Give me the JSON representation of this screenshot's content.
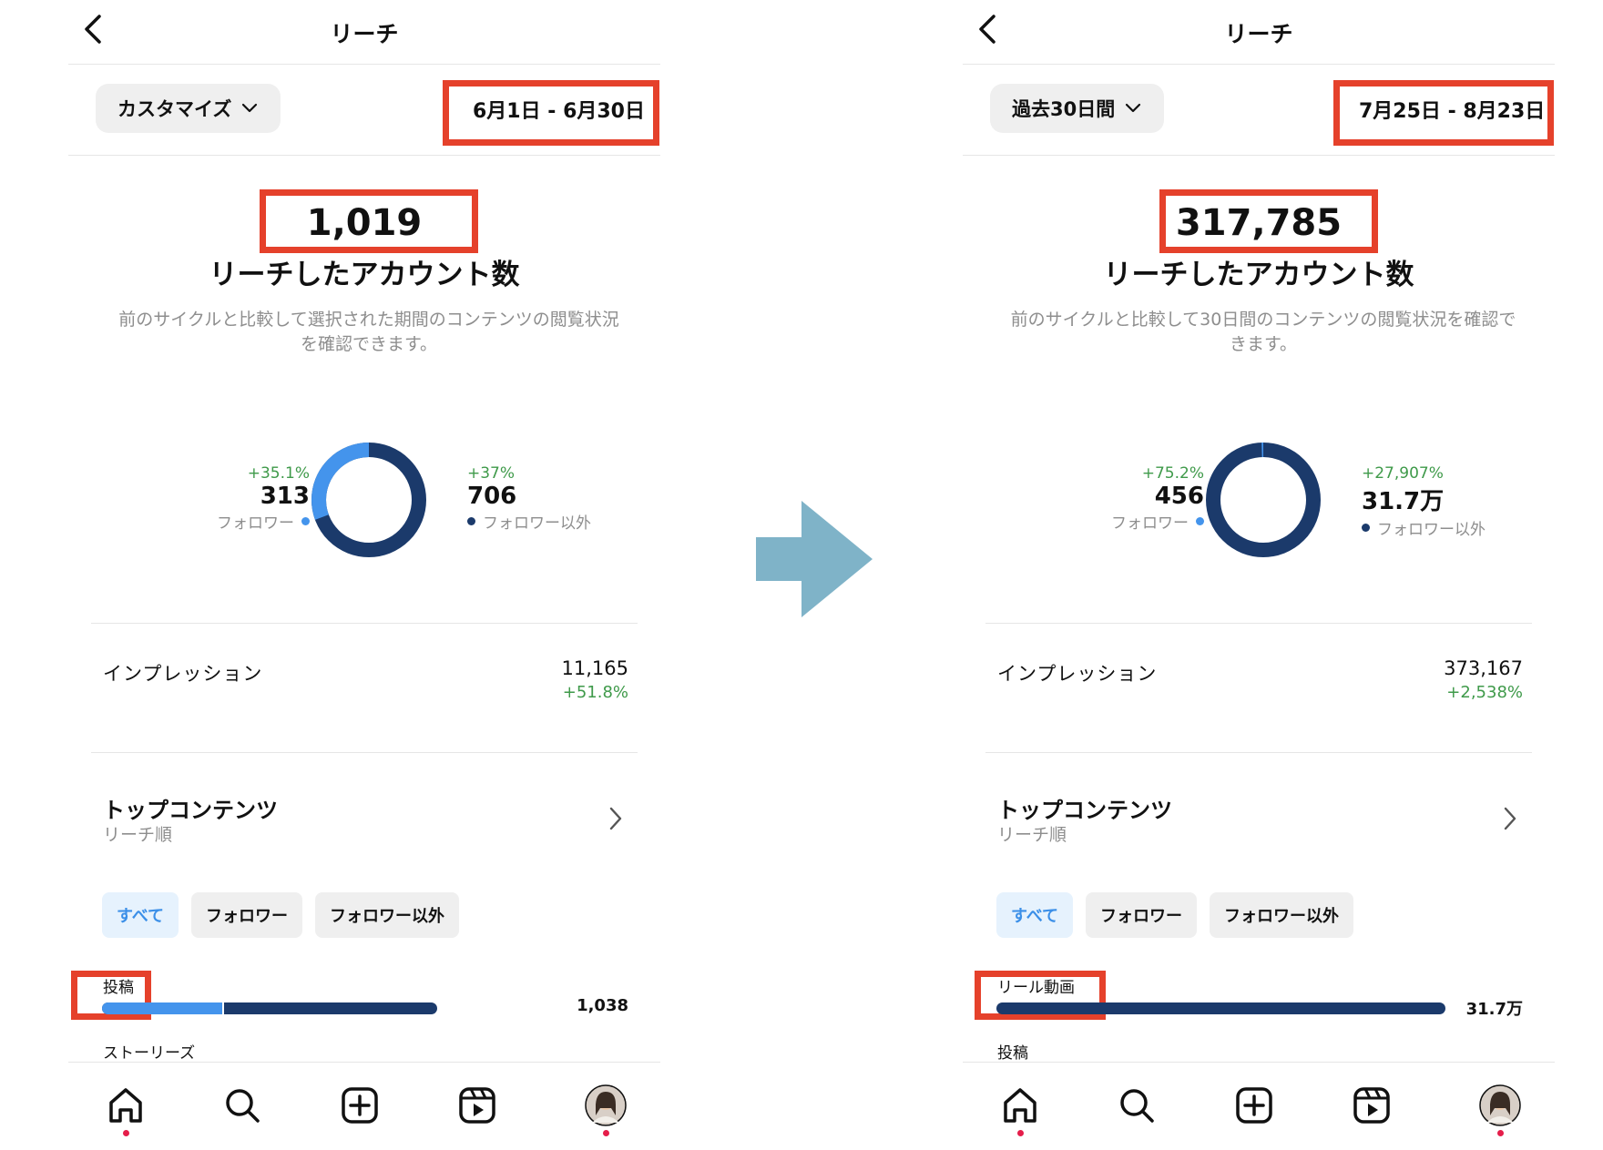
{
  "colors": {
    "accent_blue": "#4494ec",
    "navy": "#1b3a6b",
    "positive_green": "#3f9a4a",
    "highlight_red": "#e5412b",
    "arrow": "#7fb3c8",
    "notification_dot": "#e51d4a"
  },
  "icons": {
    "back": "chevron-left-icon",
    "period": "chevron-down-icon",
    "top_content": "chevron-right-icon",
    "nav": [
      "home-icon",
      "search-icon",
      "create-icon",
      "reels-icon",
      "profile-avatar"
    ],
    "between_panels": "arrow-right-icon"
  },
  "left": {
    "title": "リーチ",
    "period_selector": "カスタマイズ",
    "date_range": "6月1日 - 6月30日",
    "accounts_reached": "1,019",
    "accounts_reached_label": "リーチしたアカウント数",
    "description": "前のサイクルと比較して選択された期間のコンテンツの閲覧状況を確認できます。",
    "followers": {
      "pct": "+35.1%",
      "count": "313",
      "label": "フォロワー"
    },
    "non_followers": {
      "pct": "+37%",
      "count": "706",
      "label": "フォロワー以外"
    },
    "follower_share": 0.307,
    "impressions": {
      "label": "インプレッション",
      "value": "11,165",
      "pct": "+51.8%"
    },
    "top_content": {
      "title": "トップコンテンツ",
      "subtitle": "リーチ順"
    },
    "filters": [
      "すべて",
      "フォロワー",
      "フォロワー以外"
    ],
    "category_1": "投稿",
    "category_1_value": "1,038",
    "category_1_follower_share": 0.36,
    "category_2": "ストーリーズ"
  },
  "right": {
    "title": "リーチ",
    "period_selector": "過去30日間",
    "date_range": "7月25日 - 8月23日",
    "accounts_reached": "317,785",
    "accounts_reached_label": "リーチしたアカウント数",
    "description": "前のサイクルと比較して30日間のコンテンツの閲覧状況を確認できます。",
    "followers": {
      "pct": "+75.2%",
      "count": "456",
      "label": "フォロワー"
    },
    "non_followers": {
      "pct": "+27,907%",
      "count": "31.7万",
      "label": "フォロワー以外"
    },
    "follower_share": 0.0014,
    "impressions": {
      "label": "インプレッション",
      "value": "373,167",
      "pct": "+2,538%"
    },
    "top_content": {
      "title": "トップコンテンツ",
      "subtitle": "リーチ順"
    },
    "filters": [
      "すべて",
      "フォロワー",
      "フォロワー以外"
    ],
    "category_1": "リール動画",
    "category_1_value": "31.7万",
    "category_1_follower_share": 0.0,
    "category_2": "投稿"
  }
}
